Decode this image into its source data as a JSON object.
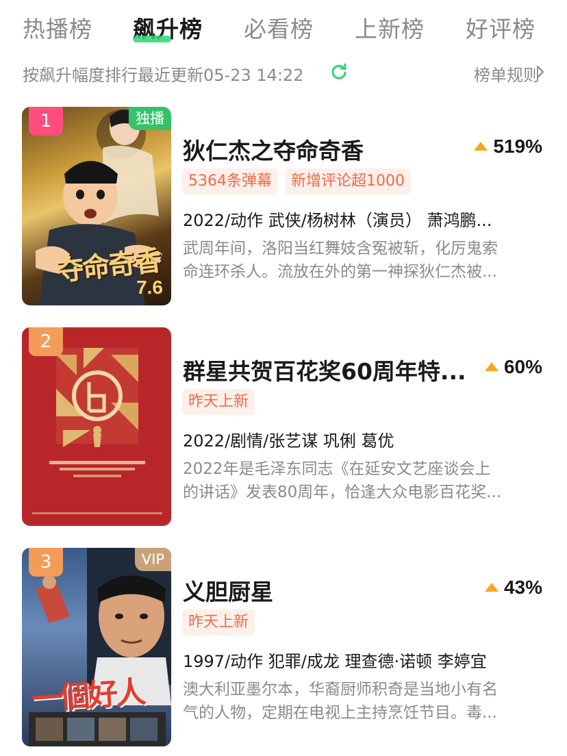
{
  "tabs": [
    {
      "label": "热播榜"
    },
    {
      "label": "飙升榜"
    },
    {
      "label": "必看榜"
    },
    {
      "label": "上新榜"
    },
    {
      "label": "好评榜"
    }
  ],
  "active_tab": "飙升榜",
  "subbar": {
    "sort_text": "按飙升幅度排行最近更新05-23 14:22",
    "rules_label": "榜单规则"
  },
  "colors": {
    "accent_green": "#2ed573",
    "rise_arrow": "#f5a623",
    "tag_text": "#ee6b4a",
    "rank_pink": "#ff4d7e",
    "rank_orange": "#f39c5a",
    "badge_green": "#37c26a",
    "badge_vip": "#c9a27a"
  },
  "items": [
    {
      "rank": "1",
      "badge": "独播",
      "score": "7.6",
      "poster_text": "夺命奇香",
      "title": "狄仁杰之夺命奇香",
      "rise": "519%",
      "tags": [
        "5364条弹幕",
        "新增评论超1000"
      ],
      "meta": "2022/动作 武侠/杨树林（演员） 萧鸿鹏...",
      "desc_line1": "武周年间，洛阳当红舞妓含冤被斩，化厉鬼索",
      "desc_line2": "命连环杀人。流放在外的第一神探狄仁杰被..."
    },
    {
      "rank": "2",
      "badge": "",
      "score": "",
      "poster_text": "",
      "title": "群星共贺百花奖60周年特...",
      "rise": "60%",
      "tags": [
        "昨天上新"
      ],
      "meta": "2022/剧情/张艺谋 巩俐 葛优",
      "desc_line1": "2022年是毛泽东同志《在延安文艺座谈会上",
      "desc_line2": "的讲话》发表80周年，恰逢大众电影百花奖..."
    },
    {
      "rank": "3",
      "badge": "VIP",
      "score": "",
      "poster_text": "一個好人",
      "title": "义胆厨星",
      "rise": "43%",
      "tags": [
        "昨天上新"
      ],
      "meta": "1997/动作 犯罪/成龙 理查德·诺顿 李婷宜",
      "desc_line1": "澳大利亚墨尔本，华裔厨师积奇是当地小有名",
      "desc_line2": "气的人物，定期在电视上主持烹饪节目。毒..."
    }
  ]
}
